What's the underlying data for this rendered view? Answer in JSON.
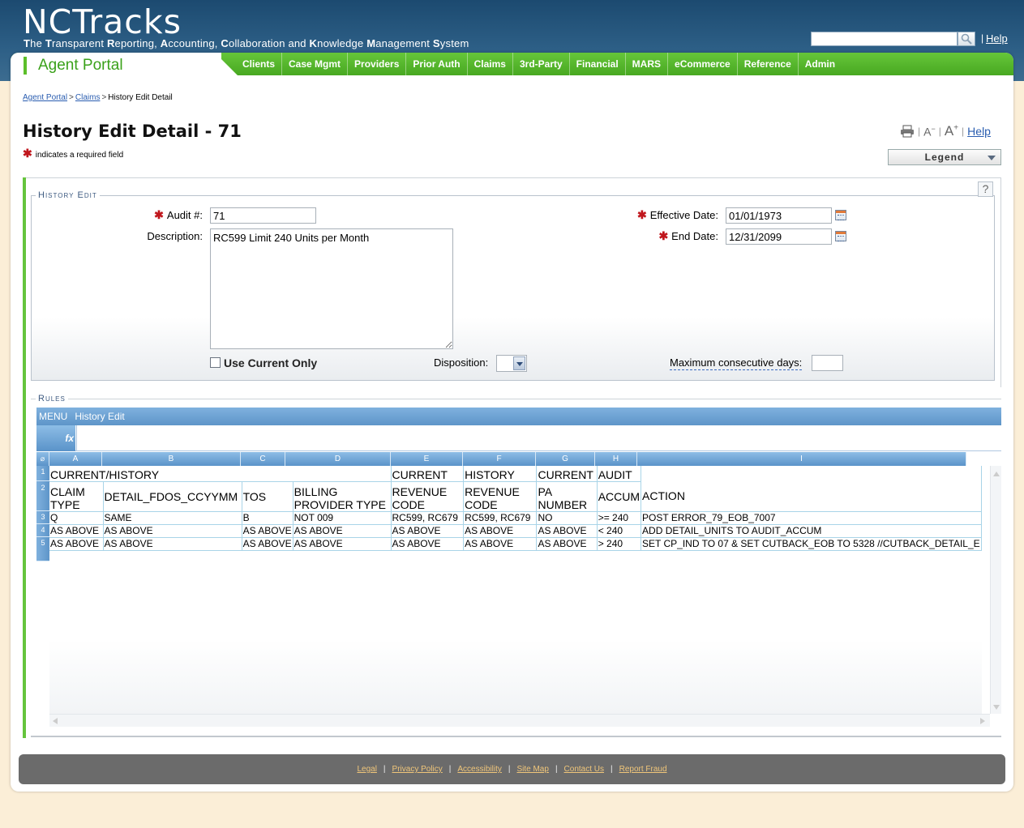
{
  "header": {
    "logo": "NCTracks",
    "tagline_parts": [
      {
        "cap": "T",
        "rest": "he "
      },
      {
        "cap": "T",
        "rest": "ransparent "
      },
      {
        "cap": "R",
        "rest": "eporting, "
      },
      {
        "cap": "A",
        "rest": "ccounting, "
      },
      {
        "cap": "C",
        "rest": "ollaboration and "
      },
      {
        "cap": "K",
        "rest": "nowledge "
      },
      {
        "cap": "M",
        "rest": "anagement "
      },
      {
        "cap": "S",
        "rest": "ystem"
      }
    ],
    "search_value": "",
    "help_label": "Help"
  },
  "portal": {
    "title": "Agent Portal"
  },
  "nav": [
    "Clients",
    "Case Mgmt",
    "Providers",
    "Prior Auth",
    "Claims",
    "3rd-Party",
    "Financial",
    "MARS",
    "eCommerce",
    "Reference",
    "Admin"
  ],
  "breadcrumb": {
    "items": [
      "Agent Portal",
      "Claims"
    ],
    "current": "History Edit Detail"
  },
  "page": {
    "title": "History Edit Detail - 71",
    "required_note": "indicates a required field",
    "help_label": "Help",
    "font_smaller": "A",
    "font_larger": "A",
    "legend_label": "Legend"
  },
  "history_edit": {
    "section_label": "History Edit",
    "help_glyph": "?",
    "audit_label": "Audit #:",
    "audit_value": "71",
    "description_label": "Description:",
    "description_value": "RC599 Limit 240 Units per Month",
    "effective_label": "Effective Date:",
    "effective_value": "01/01/1973",
    "end_label": "End Date:",
    "end_value": "12/31/2099",
    "use_current_label": "Use Current Only",
    "use_current_checked": false,
    "disposition_label": "Disposition:",
    "disposition_value": "",
    "max_days_label": "Maximum consecutive days:",
    "max_days_value": ""
  },
  "rules": {
    "section_label": "Rules",
    "menu_label": "MENU",
    "menu_title": "History Edit",
    "fx_label": "fx",
    "columns": [
      "A",
      "B",
      "C",
      "D",
      "E",
      "F",
      "G",
      "H",
      "I"
    ],
    "row_numbers": [
      "1",
      "2",
      "3",
      "4",
      "5"
    ],
    "row1": [
      "CURRENT/HISTORY",
      "",
      "",
      "",
      "CURRENT",
      "HISTORY",
      "CURRENT",
      "AUDIT",
      ""
    ],
    "row2": [
      "CLAIM TYPE",
      "DETAIL_FDOS_CCYYMM",
      "TOS",
      "BILLING PROVIDER TYPE",
      "REVENUE CODE",
      "REVENUE CODE",
      "PA NUMBER",
      "ACCUM",
      "ACTION"
    ],
    "data_rows": [
      [
        "Q",
        "SAME",
        "B",
        "NOT 009",
        "RC599, RC679",
        "RC599, RC679",
        "NO",
        ">= 240",
        "POST ERROR_79_EOB_7007"
      ],
      [
        "AS ABOVE",
        "AS ABOVE",
        "AS ABOVE",
        "AS ABOVE",
        "AS ABOVE",
        "AS ABOVE",
        "AS ABOVE",
        "< 240",
        "ADD DETAIL_UNITS TO AUDIT_ACCUM"
      ],
      [
        "AS ABOVE",
        "AS ABOVE",
        "AS ABOVE",
        "AS ABOVE",
        "AS ABOVE",
        "AS ABOVE",
        "AS ABOVE",
        "> 240",
        "SET CP_IND TO 07 & SET CUTBACK_EOB TO 5328 //CUTBACK_DETAIL_E"
      ]
    ]
  },
  "footer": [
    "Legal",
    "Privacy Policy",
    "Accessibility",
    "Site Map",
    "Contact Us",
    "Report Fraud"
  ],
  "colors": {
    "nav_green": "#5cbf2a",
    "header_blue": "#1c4a70",
    "required_red": "#c0161c",
    "link_blue": "#2a5db0",
    "sheet_blue": "#6fa3d4"
  }
}
